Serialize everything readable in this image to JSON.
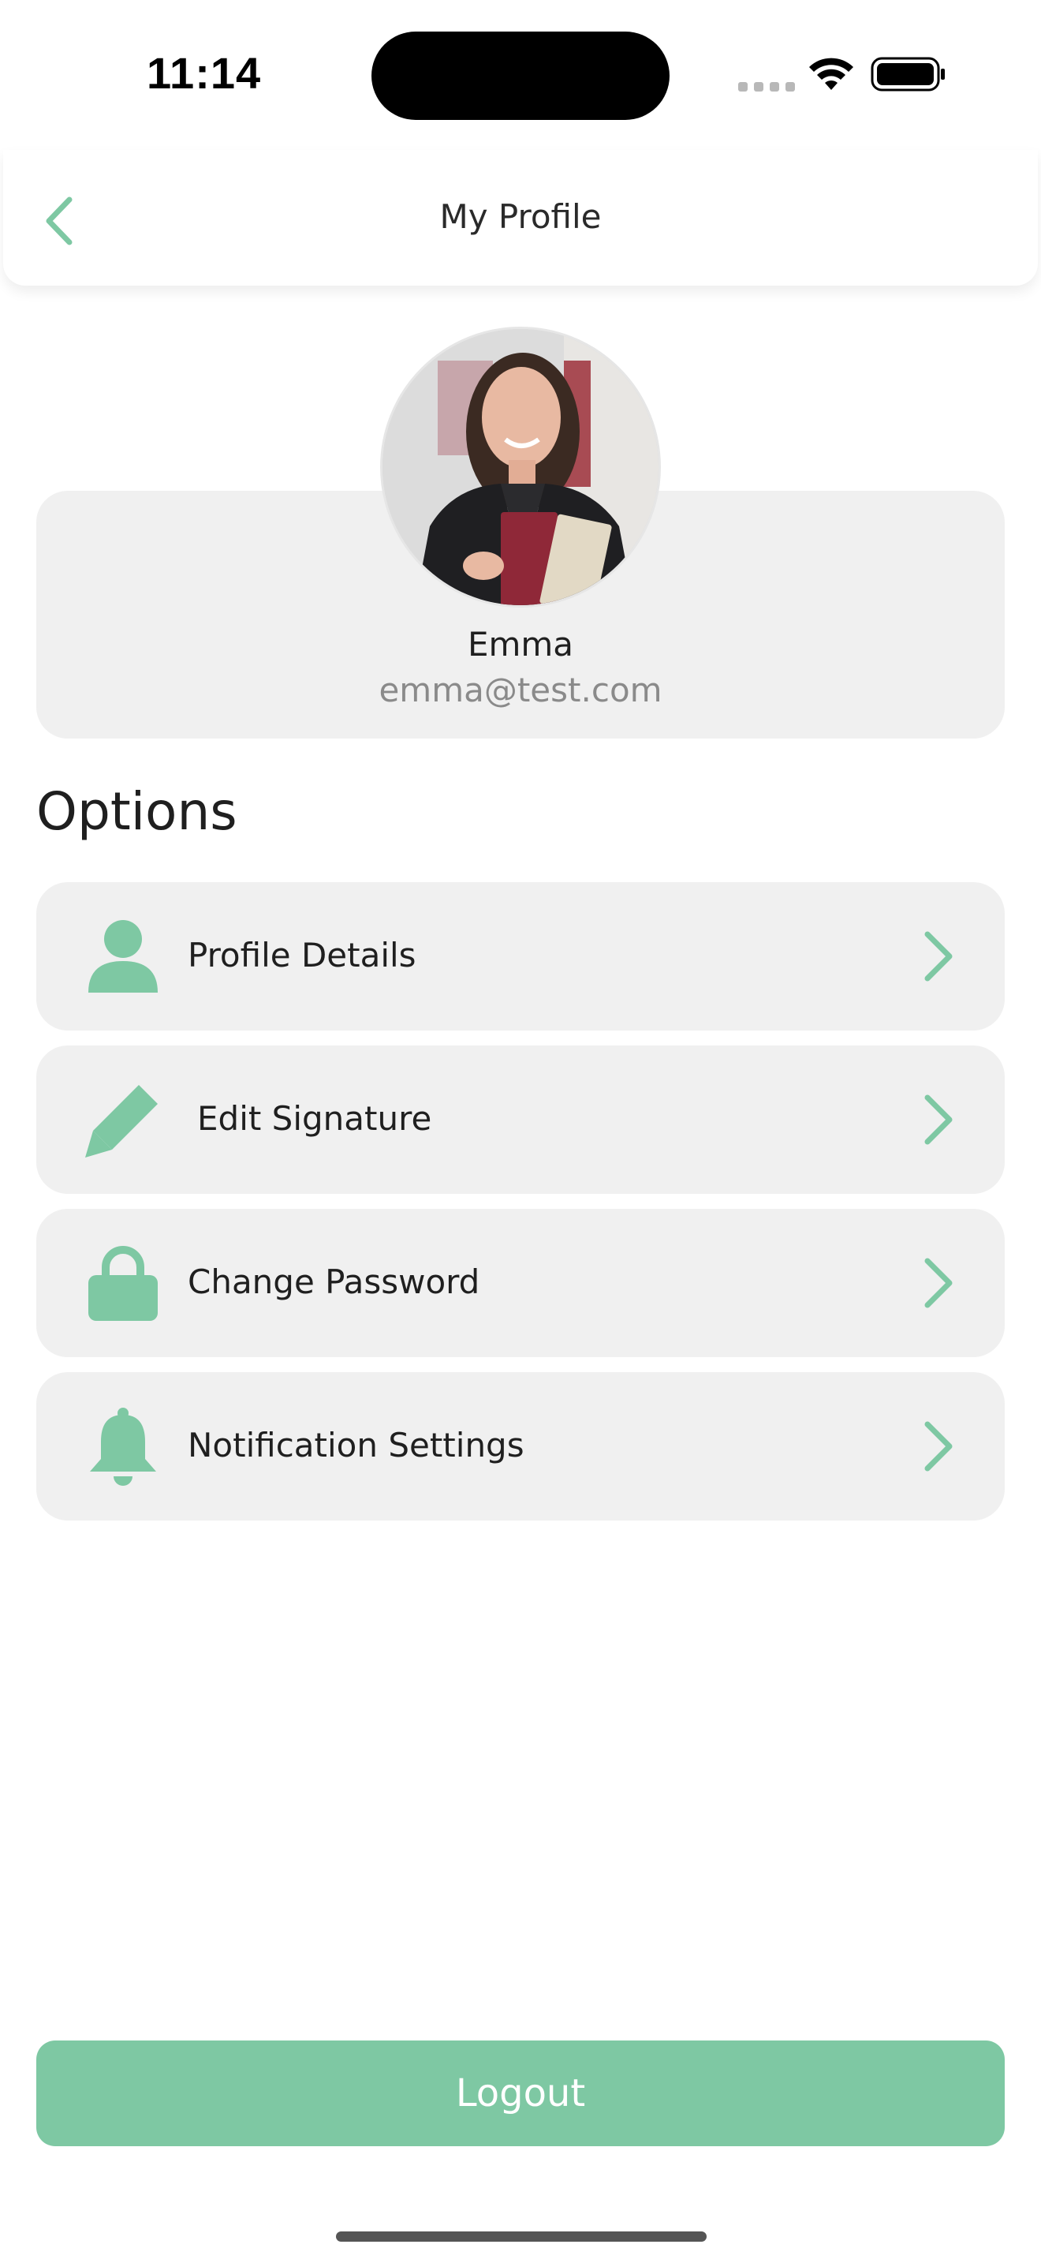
{
  "status_bar": {
    "time": "11:14"
  },
  "header": {
    "title": "My Profile",
    "back_icon": "chevron-left-icon"
  },
  "profile": {
    "name": "Emma",
    "email": "emma@test.com"
  },
  "options": {
    "title": "Options",
    "items": [
      {
        "label": "Profile Details",
        "icon": "user-icon"
      },
      {
        "label": "Edit Signature",
        "icon": "pencil-icon"
      },
      {
        "label": "Change Password",
        "icon": "lock-icon"
      },
      {
        "label": "Notification Settings",
        "icon": "bell-icon"
      }
    ]
  },
  "logout": {
    "label": "Logout"
  },
  "colors": {
    "accent": "#7ec8a3",
    "card": "#f0f0f0",
    "text": "#1f1f1f",
    "muted": "#8a8a8a"
  }
}
